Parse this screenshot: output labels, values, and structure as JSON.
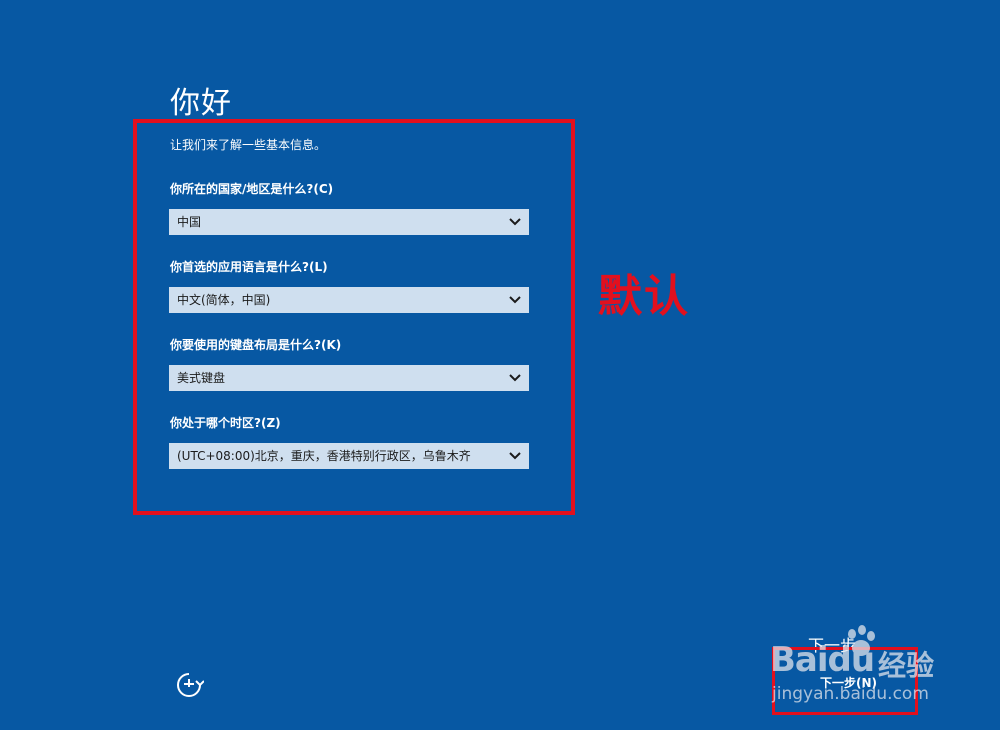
{
  "page": {
    "title": "你好",
    "intro": "让我们来了解一些基本信息。"
  },
  "fields": [
    {
      "question": "你所在的国家/地区是什么?(C)",
      "value": "中国"
    },
    {
      "question": "你首选的应用语言是什么?(L)",
      "value": "中文(简体，中国)"
    },
    {
      "question": "你要使用的键盘布局是什么?(K)",
      "value": "美式键盘"
    },
    {
      "question": "你处于哪个时区?(Z)",
      "value": "(UTC+08:00)北京，重庆，香港特别行政区，乌鲁木齐"
    }
  ],
  "annotation": "默认",
  "footer": {
    "next_label": "下一步",
    "next_label_shortcut": "下一步(N)"
  },
  "watermark": {
    "brand": "Baidu",
    "product": "经验",
    "url": "jingyan.baidu.com"
  },
  "icons": {
    "ease_of_access": "ease-of-access-icon",
    "dropdown": "chevron-down-icon"
  },
  "colors": {
    "background": "#0758a3",
    "select_bg": "#cfdfef",
    "annotation_red": "#e2101e"
  }
}
